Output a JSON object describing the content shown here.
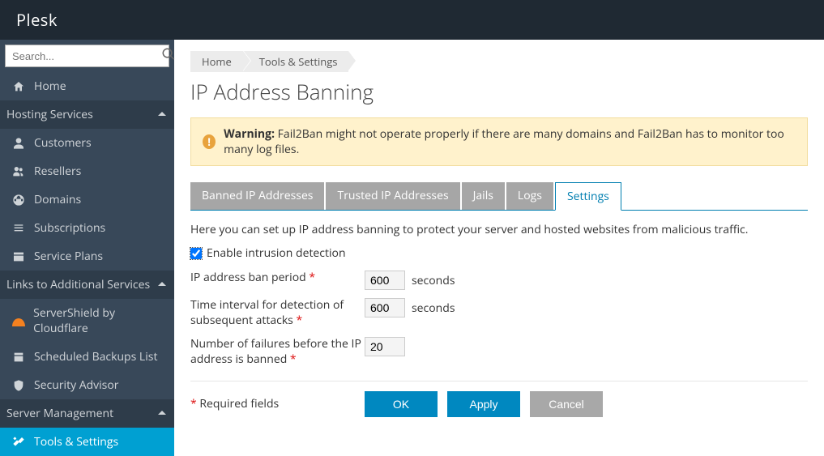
{
  "brand": "Plesk",
  "search": {
    "placeholder": "Search..."
  },
  "nav": {
    "home": "Home",
    "sections": {
      "hosting": "Hosting Services",
      "links": "Links to Additional Services",
      "server": "Server Management"
    },
    "items": {
      "customers": "Customers",
      "resellers": "Resellers",
      "domains": "Domains",
      "subscriptions": "Subscriptions",
      "servicePlans": "Service Plans",
      "serverShield": "ServerShield by Cloudflare",
      "backups": "Scheduled Backups List",
      "security": "Security Advisor",
      "tools": "Tools & Settings"
    }
  },
  "breadcrumb": {
    "home": "Home",
    "tools": "Tools & Settings"
  },
  "page": {
    "title": "IP Address Banning"
  },
  "alert": {
    "prefix": "Warning:",
    "text": " Fail2Ban might not operate properly if there are many domains and Fail2Ban has to monitor too many log files."
  },
  "tabs": {
    "banned": "Banned IP Addresses",
    "trusted": "Trusted IP Addresses",
    "jails": "Jails",
    "logs": "Logs",
    "settings": "Settings"
  },
  "desc": "Here you can set up IP address banning to protect your server and hosted websites from malicious traffic.",
  "form": {
    "enableLabel": "Enable intrusion detection",
    "banPeriod": {
      "label": "IP address ban period",
      "value": "600",
      "unit": "seconds"
    },
    "interval": {
      "label": "Time interval for detection of subsequent attacks",
      "value": "600",
      "unit": "seconds"
    },
    "failures": {
      "label": "Number of failures before the IP address is banned",
      "value": "20"
    },
    "star": "*",
    "reqNote": " Required fields"
  },
  "buttons": {
    "ok": "OK",
    "apply": "Apply",
    "cancel": "Cancel"
  }
}
